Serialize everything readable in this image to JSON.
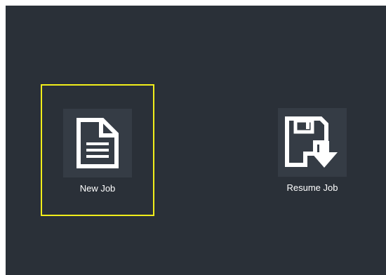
{
  "tiles": [
    {
      "label": "New Job",
      "icon": "document-icon",
      "selected": true
    },
    {
      "label": "Resume Job",
      "icon": "save-download-icon",
      "selected": false
    }
  ],
  "colors": {
    "background": "#2a3038",
    "icon_box": "#353c45",
    "selection": "#f1ee1a",
    "label": "#ffffff"
  }
}
